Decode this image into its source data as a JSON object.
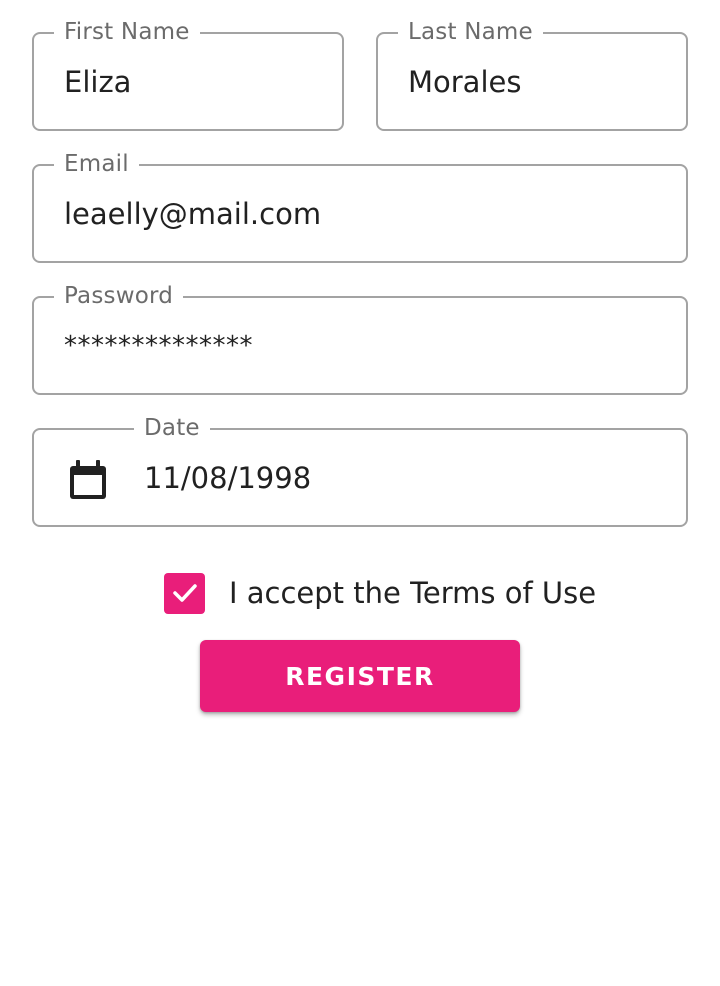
{
  "form": {
    "first_name": {
      "label": "First Name",
      "value": "Eliza"
    },
    "last_name": {
      "label": "Last Name",
      "value": "Morales"
    },
    "email": {
      "label": "Email",
      "value": "leaelly@mail.com"
    },
    "password": {
      "label": "Password",
      "value": "**************"
    },
    "date": {
      "label": "Date",
      "value": "11/08/1998",
      "icon": "calendar-icon"
    },
    "terms": {
      "label": "I accept the Terms of Use",
      "checked": true
    },
    "register_label": "REGISTER"
  },
  "colors": {
    "accent": "#e91e7a",
    "border": "#a3a3a3",
    "label": "#6b6b6b",
    "text": "#212121"
  }
}
